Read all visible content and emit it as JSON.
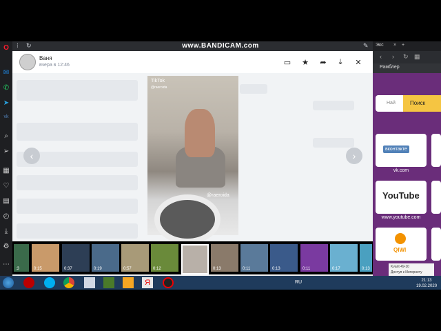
{
  "recorder": {
    "watermark": "www.BANDICAM.com"
  },
  "viewer": {
    "user_name": "Ваня",
    "time": "вчера в 12:46",
    "tiktok_logo": "TikTok",
    "tiktok_handle": "@raeroida",
    "video_watermark": "@raeroida"
  },
  "thumbnails": [
    {
      "duration": ":3"
    },
    {
      "duration": "0:15"
    },
    {
      "duration": "0:37"
    },
    {
      "duration": "0:19"
    },
    {
      "duration": "0:57"
    },
    {
      "duration": "0:12"
    },
    {
      "duration": ""
    },
    {
      "duration": "0:13"
    },
    {
      "duration": "0:11"
    },
    {
      "duration": "0:13"
    },
    {
      "duration": "0:11"
    },
    {
      "duration": "0:17"
    },
    {
      "duration": "0:13"
    }
  ],
  "right_panel": {
    "tab_label": "Экс",
    "bookmark": "Рамблер",
    "search_placeholder": "Най",
    "search_button": "Поиск",
    "tiles": [
      {
        "name": "вконтакте",
        "caption": "vk.com"
      },
      {
        "name": "YouTube",
        "caption": "www.youtube.com"
      },
      {
        "name": "QIWI",
        "caption": ""
      }
    ],
    "network_name": "Kvant 49-10",
    "network_status": "Доступ к Интернету"
  },
  "taskbar": {
    "lang": "RU",
    "time": "21:13",
    "date": "19.02.2020"
  },
  "colors": {
    "accent": "#5181b8",
    "page_bg": "#f1f3f5",
    "rambler_purple": "#6a2d7a",
    "search_yellow": "#f5c542"
  }
}
